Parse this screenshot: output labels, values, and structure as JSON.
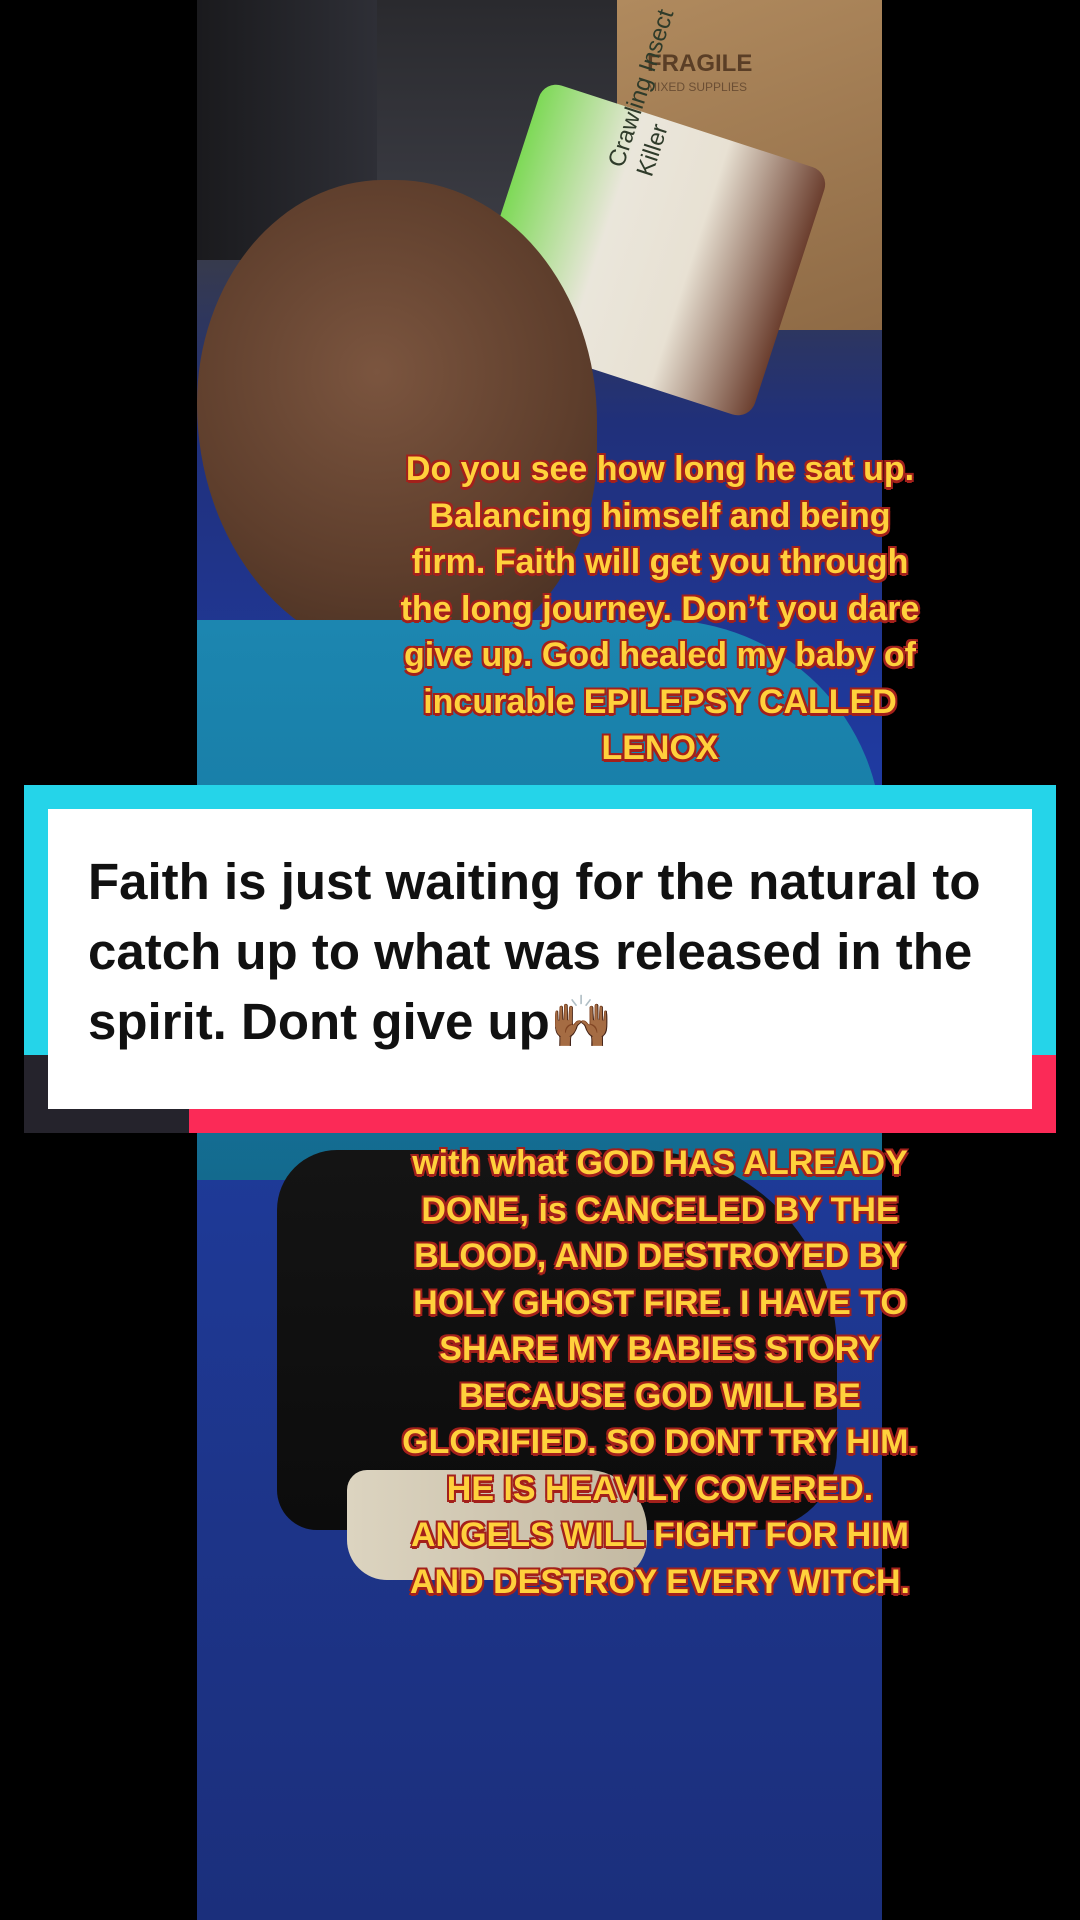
{
  "video": {
    "background_scene": {
      "box_label": "FRAGILE",
      "box_sublabel": "MIXED SUPPLIES",
      "bag_label": "Crawling Insect Killer"
    },
    "caption_top": "Do you see how long he sat up. Balancing himself and being firm. Faith will get you through the long journey. Don’t you dare give up. God healed my baby of incurable EPILEPSY CALLED LENOX",
    "caption_bottom": "with what GOD HAS ALREADY DONE, is CANCELED BY THE BLOOD, AND DESTROYED BY HOLY GHOST FIRE. I HAVE TO SHARE MY BABIES STORY BECAUSE GOD WILL BE GLORIFIED. SO DONT TRY HIM. HE IS HEAVILY COVERED. ANGELS WILL FIGHT FOR HIM AND DESTROY EVERY WITCH."
  },
  "text_card": {
    "text": "Faith is just waiting for the natural to catch up to what was released in the spirit. Dont give up🙌🏾"
  },
  "colors": {
    "caption_fill": "#ffd13c",
    "caption_outline": "#a3201b",
    "card_cyan": "#25d4e9",
    "card_red": "#fb2a57",
    "card_dark": "#25232c"
  }
}
